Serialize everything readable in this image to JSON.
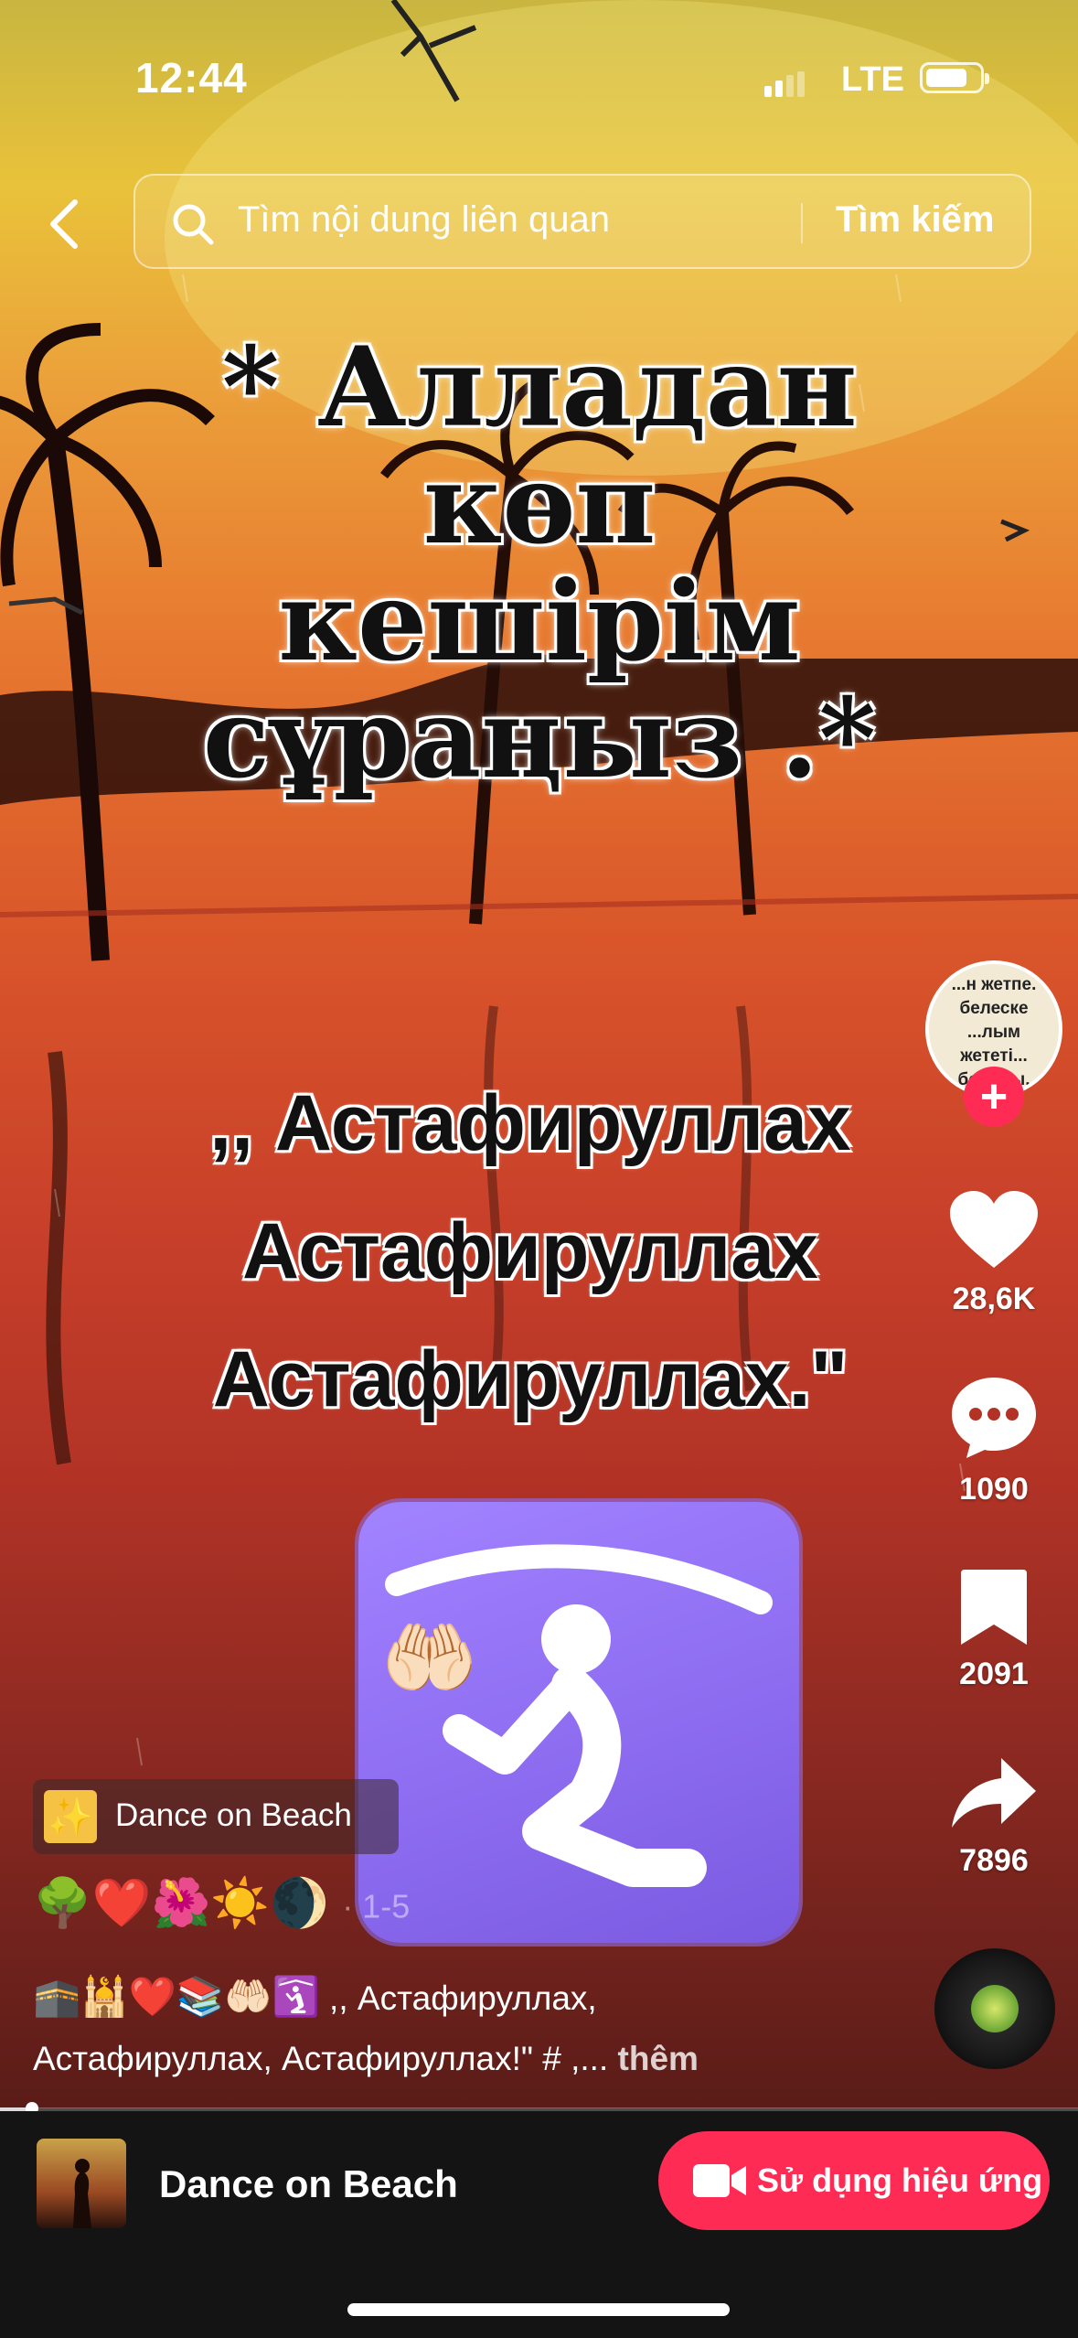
{
  "status_bar": {
    "time": "12:44",
    "network": "LTE",
    "battery_level": 0.75
  },
  "search": {
    "placeholder": "Tìm nội dung liên quan",
    "button_label": "Tìm kiếm"
  },
  "video": {
    "heading_lines": [
      "* Алладан",
      "көп",
      "кешірім",
      "сұраңыз .*"
    ],
    "subtext_lines": [
      ",, Астафируллах",
      "Астафируллах",
      "Астафируллах.\""
    ],
    "hands_emoji": "🤲🏻",
    "progress": 0.03
  },
  "creator": {
    "avatar_text": "...н жетпе. белеске ...лым жететі... болады,",
    "follow_label": "+"
  },
  "actions": {
    "likes": "28,6K",
    "comments": "1090",
    "saves": "2091",
    "shares": "7896"
  },
  "effect": {
    "icon": "✨",
    "name": "Dance on Beach"
  },
  "emoji_row": {
    "emojis": "🌳❤️🌺☀️🌒",
    "range": "· 1-5"
  },
  "caption": {
    "emojis": "🕋🕌❤️📚🤲🏻🛐",
    "text_line1": " ,, Астафируллах,",
    "text_line2": "Астафируллах, Астафируллах!\" # ,...",
    "more_label": "thêm"
  },
  "bottom_bar": {
    "title": "Dance on Beach",
    "use_effect_label": "Sử dụng hiệu ứng"
  },
  "colors": {
    "accent": "#fe2c55",
    "tile_purple": "#8f6ef2",
    "bottom_bg": "#141414"
  }
}
